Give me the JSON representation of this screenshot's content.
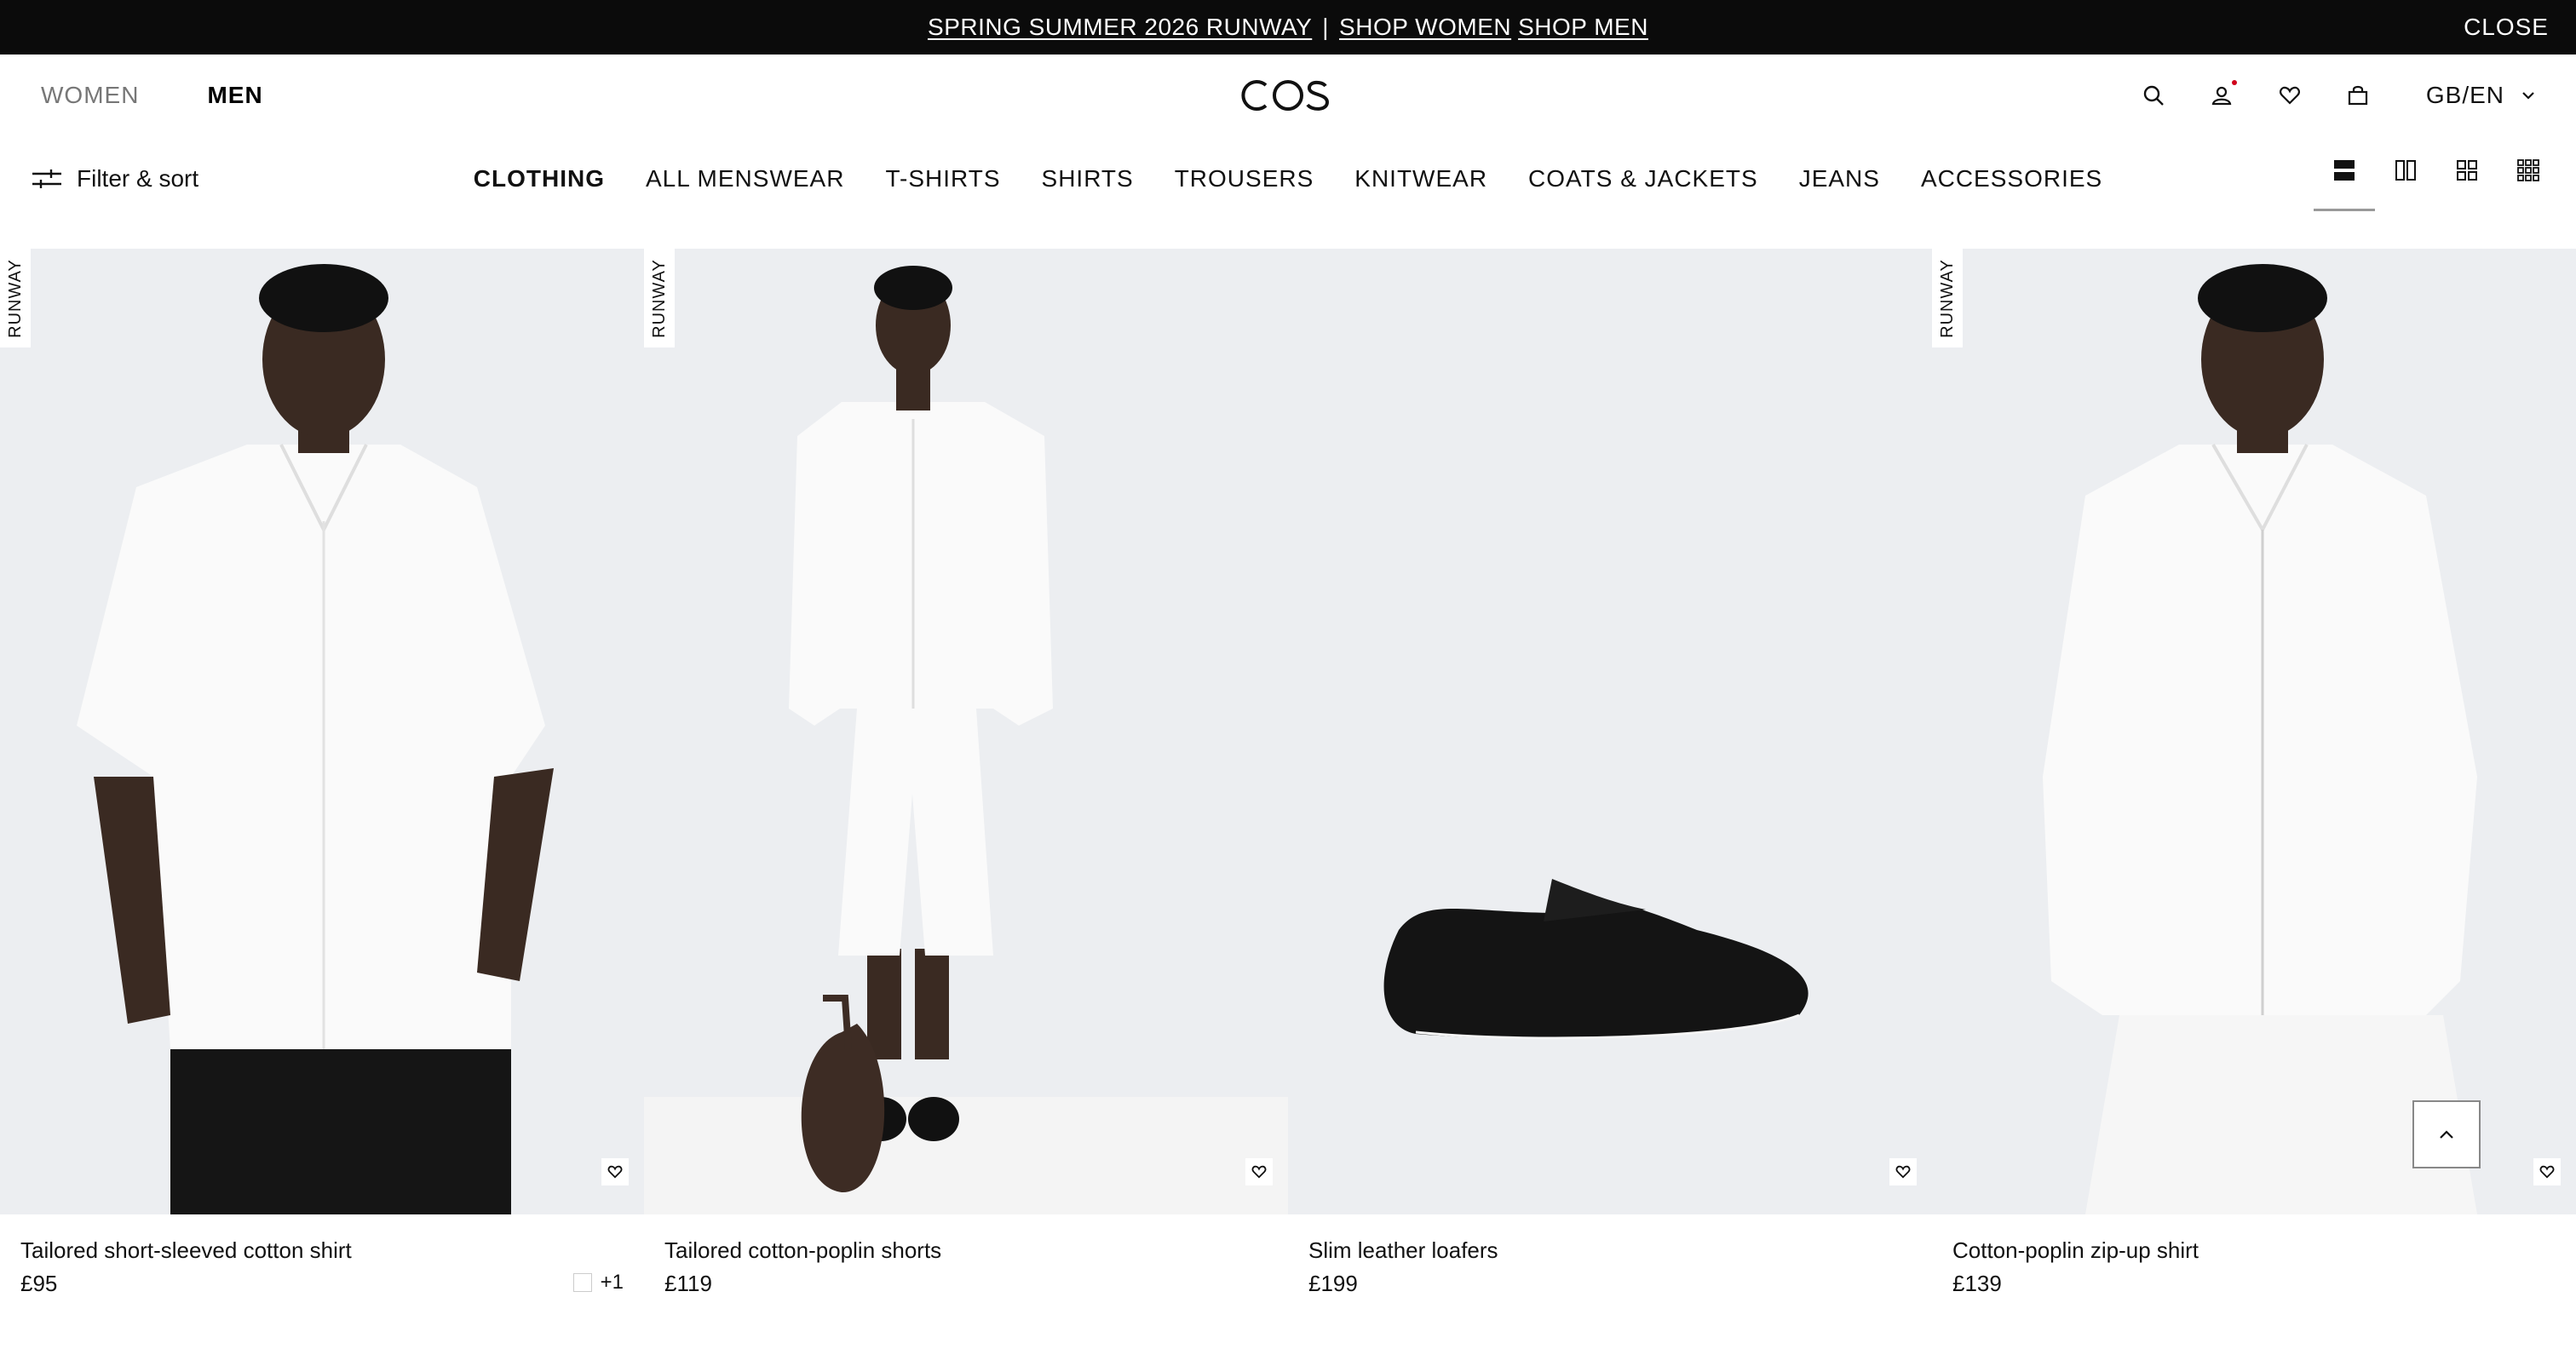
{
  "announcement": {
    "link1": "SPRING SUMMER 2026 RUNWAY",
    "separator": "|",
    "link2": "SHOP WOMEN",
    "link3": "SHOP MEN",
    "close": "CLOSE"
  },
  "header": {
    "women": "WOMEN",
    "men": "MEN",
    "logo": "COS",
    "locale": "GB/EN",
    "icons": [
      "search-icon",
      "account-icon",
      "heart-icon",
      "bag-icon"
    ]
  },
  "filter": {
    "label": "Filter & sort"
  },
  "categories": [
    "CLOTHING",
    "ALL MENSWEAR",
    "T-SHIRTS",
    "SHIRTS",
    "TROUSERS",
    "KNITWEAR",
    "COATS & JACKETS",
    "JEANS",
    "ACCESSORIES"
  ],
  "active_category": "CLOTHING",
  "view_options": [
    "view-1-column-icon",
    "view-2-column-icon",
    "view-4-grid-icon",
    "view-9-grid-icon"
  ],
  "selected_view": "view-1-column-icon",
  "products": [
    {
      "badge": "RUNWAY",
      "name": "Tailored short-sleeved cotton shirt",
      "price": "£95",
      "more_colours": "+1"
    },
    {
      "badge": "RUNWAY",
      "name": "Tailored cotton-poplin shorts",
      "price": "£119"
    },
    {
      "badge": "",
      "name": "Slim leather loafers",
      "price": "£199"
    },
    {
      "badge": "RUNWAY",
      "name": "Cotton-poplin zip-up shirt",
      "price": "£139"
    }
  ],
  "colors": {
    "bar": "#0b0b0b",
    "image_bg": "#eceef1",
    "notification_dot": "#d0021b"
  }
}
